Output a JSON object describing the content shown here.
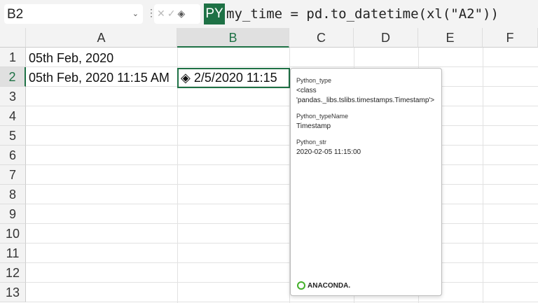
{
  "name_box": "B2",
  "formula_bar": {
    "py_badge": "PY",
    "formula": "my_time = pd.to_datetime(xl(\"A2\"))"
  },
  "columns": [
    "A",
    "B",
    "C",
    "D",
    "E",
    "F"
  ],
  "rows": [
    "1",
    "2",
    "3",
    "4",
    "5",
    "6",
    "7",
    "8",
    "9",
    "10",
    "11",
    "12",
    "13"
  ],
  "cells": {
    "A1": "05th Feb, 2020",
    "A2": "05th Feb, 2020 11:15 AM",
    "B2": "2/5/2020 11:15"
  },
  "card": {
    "fields": [
      {
        "label": "Python_type",
        "value": "<class 'pandas._libs.tslibs.timestamps.Timestamp'>"
      },
      {
        "label": "Python_typeName",
        "value": "Timestamp"
      },
      {
        "label": "Python_str",
        "value": "2020-02-05 11:15:00"
      }
    ],
    "logo": "ANACONDA."
  },
  "colors": {
    "accent": "#1e7145",
    "anaconda": "#43b02a"
  }
}
